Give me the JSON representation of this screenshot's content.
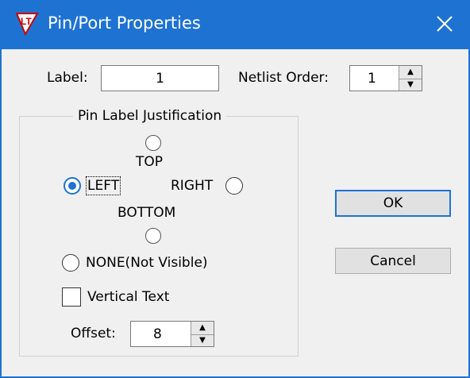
{
  "window": {
    "title": "Pin/Port Properties",
    "app_icon": "ltspice-icon",
    "close_icon": "close-icon"
  },
  "label_field": {
    "label": "Label:",
    "value": "1"
  },
  "netlist_order": {
    "label": "Netlist Order:",
    "value": "1"
  },
  "justification": {
    "group_title": "Pin Label Justification",
    "options": {
      "top": "TOP",
      "left": "LEFT",
      "right": "RIGHT",
      "bottom": "BOTTOM",
      "none": "NONE(Not Visible)"
    },
    "selected": "LEFT"
  },
  "vertical_text": {
    "label": "Vertical Text",
    "checked": false
  },
  "offset": {
    "label": "Offset:",
    "value": "8"
  },
  "buttons": {
    "ok": "OK",
    "cancel": "Cancel"
  },
  "colors": {
    "title_bar": "#1e73d2",
    "accent": "#1e73d2",
    "background": "#f0f0f0"
  }
}
